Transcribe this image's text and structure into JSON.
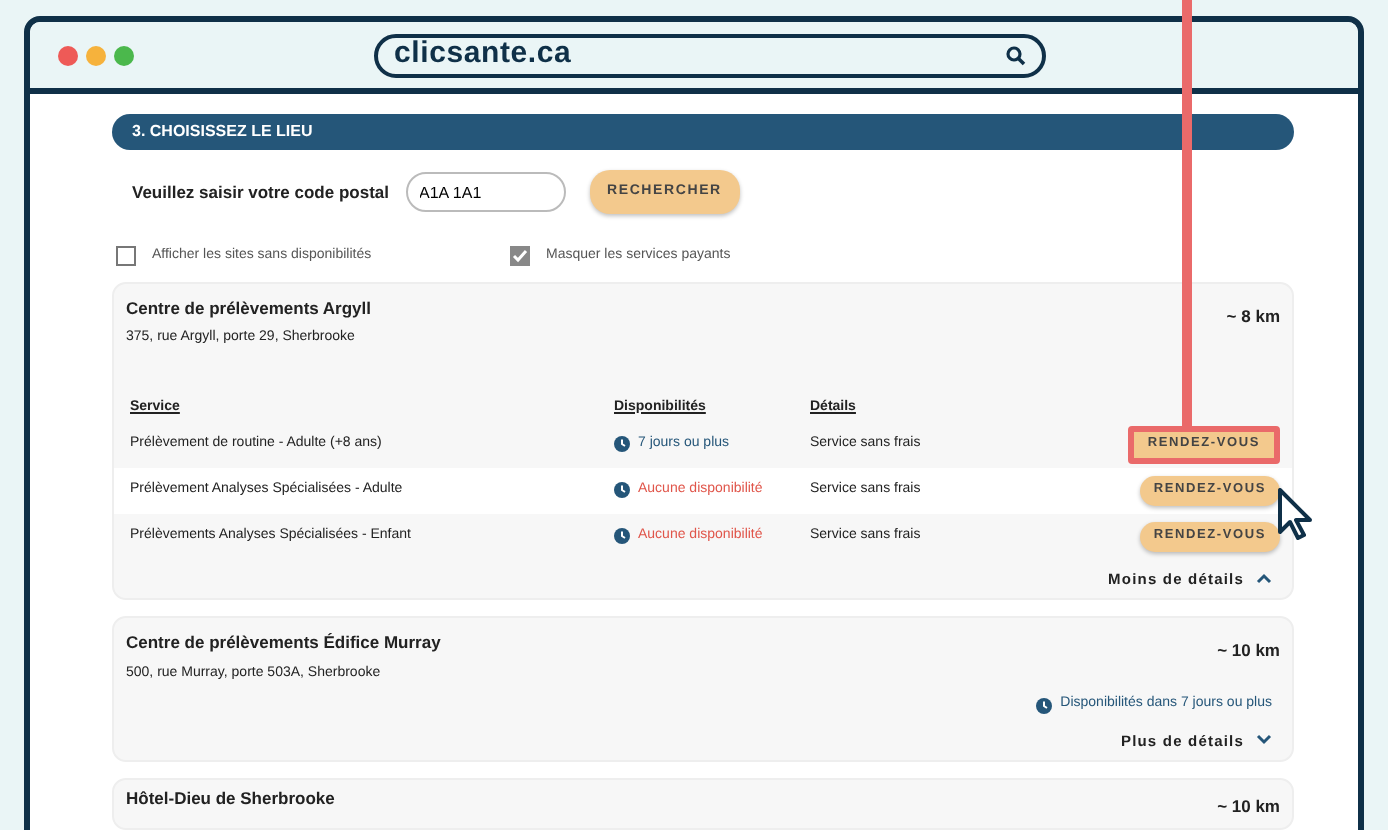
{
  "browser": {
    "address": "clicsante.ca"
  },
  "section_title": "3. CHOISISSEZ LE LIEU",
  "postal": {
    "label": "Veuillez saisir votre code postal",
    "value": "A1A 1A1",
    "button": "RECHERCHER"
  },
  "filters": [
    {
      "label": "Afficher les sites sans disponibilités",
      "checked": false
    },
    {
      "label": "Masquer les services payants",
      "checked": true
    }
  ],
  "sites": [
    {
      "name": "Centre de prélèvements Argyll",
      "address": "375, rue Argyll, porte 29, Sherbrooke",
      "distance": "~ 8 km",
      "expanded": true,
      "columns": [
        "Service",
        "Disponibilités",
        "Détails"
      ],
      "services": [
        {
          "name": "Prélèvement de routine - Adulte (+8 ans)",
          "availability": "7 jours ou plus",
          "available": true,
          "details": "Service sans frais",
          "button": "RENDEZ-VOUS",
          "highlighted": true
        },
        {
          "name": "Prélèvement Analyses Spécialisées - Adulte",
          "availability": "Aucune disponibilité",
          "available": false,
          "details": "Service sans frais",
          "button": "RENDEZ-VOUS",
          "highlighted": false
        },
        {
          "name": "Prélèvements Analyses Spécialisées - Enfant",
          "availability": "Aucune disponibilité",
          "available": false,
          "details": "Service sans frais",
          "button": "RENDEZ-VOUS",
          "highlighted": false
        }
      ],
      "toggle": "Moins de détails"
    },
    {
      "name": "Centre de prélèvements Édifice Murray",
      "address": "500, rue Murray, porte 503A, Sherbrooke",
      "distance": "~ 10 km",
      "expanded": false,
      "summary": "Disponibilités dans 7 jours ou plus",
      "toggle": "Plus de détails"
    },
    {
      "name": "Hôtel-Dieu de Sherbrooke",
      "distance": "~ 10 km"
    }
  ]
}
